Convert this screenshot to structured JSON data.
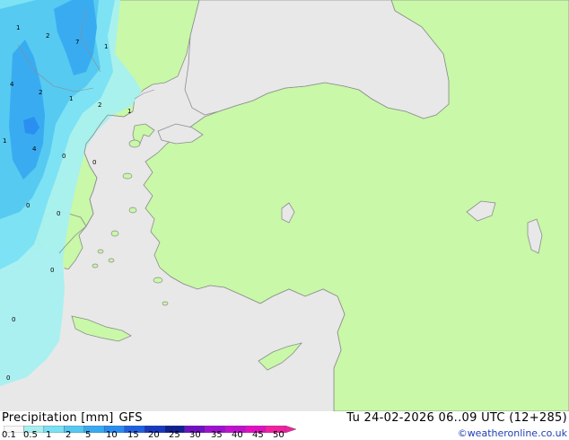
{
  "map": {
    "colors": {
      "sea": "#e8e8e8",
      "land": "#c8f8a8",
      "coast": "#8c8c8c",
      "precip_01": "#a8f0f0",
      "precip_05": "#7ae0f4",
      "precip_1": "#54c8f0",
      "precip_2": "#38aaf0",
      "precip_5": "#2a8cf0"
    },
    "point_values": [
      "1",
      "2",
      "7",
      "1",
      "4",
      "2",
      "1",
      "2",
      "1",
      "1",
      "4",
      "0",
      "0",
      "0",
      "0",
      "0",
      "0",
      "0"
    ]
  },
  "footer": {
    "title_left": "Precipitation [mm]",
    "model": "GFS",
    "valid_time": "Tu 24-02-2026 06..09 UTC (12+285)",
    "copyright": "©weatheronline.co.uk"
  },
  "legend": {
    "labels": [
      "0.1",
      "0.5",
      "1",
      "2",
      "5",
      "10",
      "15",
      "20",
      "25",
      "30",
      "35",
      "40",
      "45",
      "50"
    ],
    "colors": [
      "#f8f8f8",
      "#a8f0f0",
      "#7ae0f4",
      "#54c8f0",
      "#38aaf0",
      "#2a8cf0",
      "#2060e0",
      "#1838c0",
      "#102090",
      "#7010c0",
      "#a010d0",
      "#c010d0",
      "#e010c0",
      "#f020a0"
    ]
  }
}
